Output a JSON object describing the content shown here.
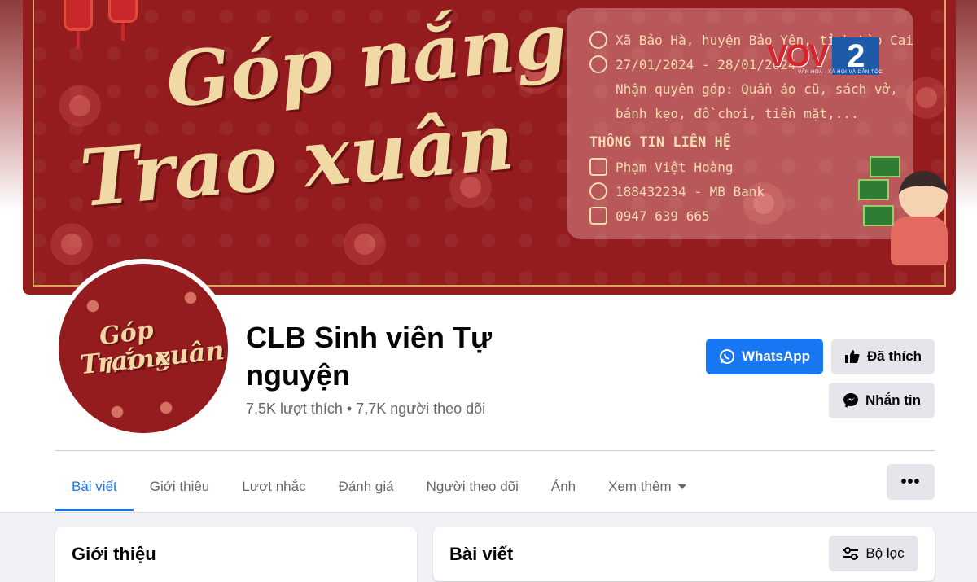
{
  "cover": {
    "title_line1": "Góp nắng",
    "title_line2": "Trao xuân",
    "address": "Xã Bảo Hà, huyện Bảo Yên, tỉnh Lào Cai",
    "dates": "27/01/2024 - 28/01/2024",
    "donation_line1": "Nhận quyên góp: Quần áo cũ, sách vở,",
    "donation_line2": "bánh kẹo, đồ chơi, tiền mặt,...",
    "contact_heading": "THÔNG TIN LIÊN HỆ",
    "contact_name": "Phạm Việt Hoàng",
    "bank": "188432234 - MB Bank",
    "phone": "0947 639 665"
  },
  "watermark": {
    "brand": "VOV",
    "channel": "2",
    "tagline": "VĂN HÓA - XÃ HỘI VÀ DÂN TỘC"
  },
  "avatar": {
    "title_line1": "Góp nắng",
    "title_line2": "Trao xuân"
  },
  "page": {
    "name": "CLB Sinh viên Tự nguyện",
    "stats": "7,5K lượt thích • 7,7K người theo dõi"
  },
  "actions": {
    "whatsapp": "WhatsApp",
    "liked": "Đã thích",
    "message": "Nhắn tin"
  },
  "tabs": [
    {
      "label": "Bài viết"
    },
    {
      "label": "Giới thiệu"
    },
    {
      "label": "Lượt nhắc"
    },
    {
      "label": "Đánh giá"
    },
    {
      "label": "Người theo dõi"
    },
    {
      "label": "Ảnh"
    },
    {
      "label": "Xem thêm"
    }
  ],
  "more_button": "•••",
  "intro_card": {
    "title": "Giới thiệu"
  },
  "posts_card": {
    "title": "Bài viết",
    "filter": "Bộ lọc"
  },
  "colors": {
    "accent": "#1877f2",
    "cover_red": "#941c1f",
    "cover_gold": "#f1d9a6",
    "button_gray": "#e4e6eb"
  }
}
